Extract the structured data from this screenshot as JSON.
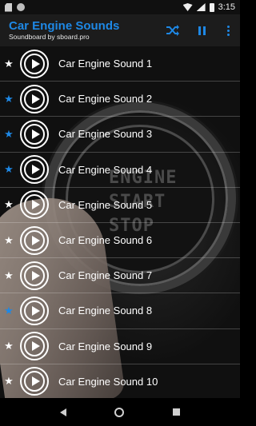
{
  "status_bar": {
    "time": "3:15",
    "icons": [
      "sd-card-icon",
      "circle-icon",
      "wifi-icon",
      "signal-icon",
      "battery-icon"
    ]
  },
  "app_bar": {
    "title": "Car Engine Sounds",
    "subtitle": "Soundboard by sboard.pro",
    "actions": [
      "shuffle-icon",
      "pause-icon",
      "overflow-menu-icon"
    ],
    "accent_color": "#1e88e5"
  },
  "background": {
    "button_text_lines": [
      "ENGINE",
      "START",
      "STOP"
    ]
  },
  "sounds": [
    {
      "label": "Car Engine Sound 1",
      "favorite": false
    },
    {
      "label": "Car Engine Sound 2",
      "favorite": true
    },
    {
      "label": "Car Engine Sound 3",
      "favorite": true
    },
    {
      "label": "Car Engine Sound 4",
      "favorite": true
    },
    {
      "label": "Car Engine Sound 5",
      "favorite": false
    },
    {
      "label": "Car Engine Sound 6",
      "favorite": false
    },
    {
      "label": "Car Engine Sound 7",
      "favorite": false
    },
    {
      "label": "Car Engine Sound 8",
      "favorite": true
    },
    {
      "label": "Car Engine Sound 9",
      "favorite": false
    },
    {
      "label": "Car Engine Sound 10",
      "favorite": false
    }
  ],
  "colors": {
    "favorite_star": "#1e88e5",
    "normal_star": "#ffffff"
  },
  "nav_bar": {
    "icons": [
      "back-icon",
      "home-icon",
      "recents-icon"
    ]
  }
}
